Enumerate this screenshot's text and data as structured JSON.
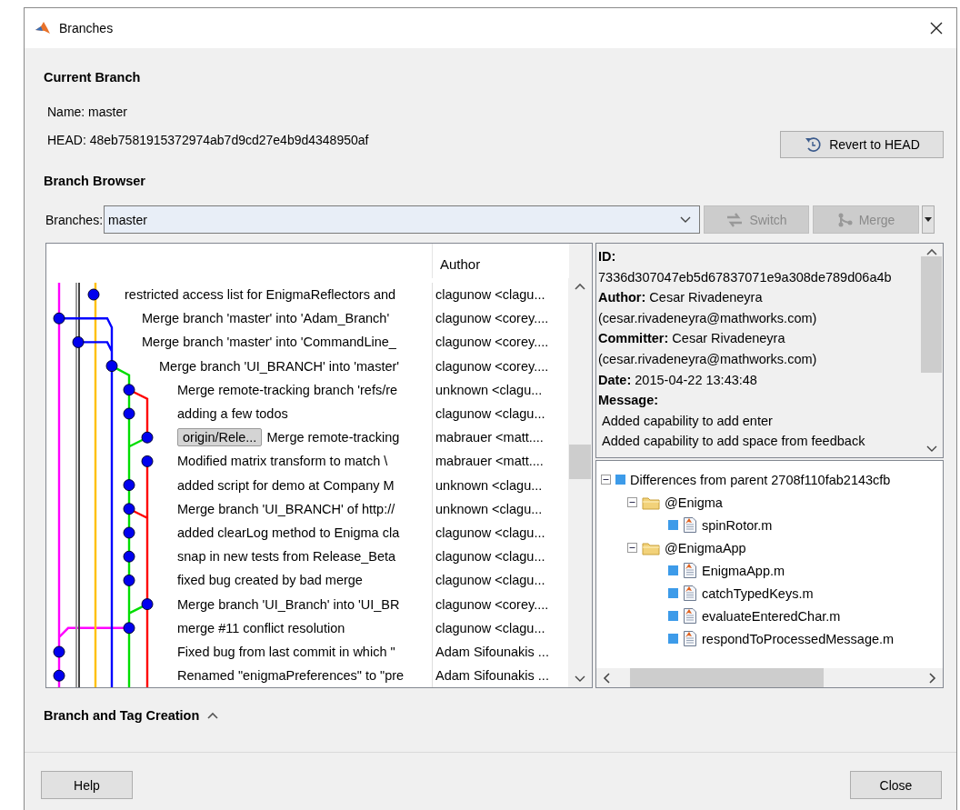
{
  "window": {
    "title": "Branches"
  },
  "current_branch": {
    "heading": "Current Branch",
    "name": "Name: master",
    "head": "HEAD: 48eb7581915372974ab7d9cd27e4b9d4348950af",
    "revert_button": "Revert to HEAD"
  },
  "branch_browser": {
    "heading": "Branch Browser",
    "branches_label": "Branches:",
    "branches_value": "master",
    "switch_button": {
      "label": "Switch",
      "disabled": true
    },
    "merge_button": {
      "label": "Merge",
      "disabled": true
    }
  },
  "commits": {
    "author_header": "Author",
    "rows": [
      {
        "message": "restricted access list for EnigmaReflectors and",
        "author": "clagunow <clagu..."
      },
      {
        "message": "Merge branch 'master' into 'Adam_Branch'",
        "author": "clagunow <corey...."
      },
      {
        "message": "Merge branch 'master' into 'CommandLine_",
        "author": "clagunow <corey...."
      },
      {
        "message": "Merge branch 'UI_BRANCH' into 'master'",
        "author": "clagunow <corey...."
      },
      {
        "message": "Merge remote-tracking branch 'refs/re",
        "author": "unknown <clagu..."
      },
      {
        "message": "adding a few todos",
        "author": "clagunow <clagu..."
      },
      {
        "tag": "origin/Rele...",
        "message": "Merge remote-tracking",
        "author": "mabrauer <matt...."
      },
      {
        "message": "Modified matrix transform to match \\",
        "author": "mabrauer <matt...."
      },
      {
        "message": "added script for demo at Company M",
        "author": "unknown <clagu..."
      },
      {
        "message": "Merge branch 'UI_BRANCH' of http://",
        "author": "unknown <clagu..."
      },
      {
        "message": "added clearLog method to Enigma cla",
        "author": "clagunow <clagu..."
      },
      {
        "message": "snap in new tests from Release_Beta",
        "author": "clagunow <clagu..."
      },
      {
        "message": "fixed bug created by bad merge",
        "author": "clagunow <clagu..."
      },
      {
        "message": "Merge branch 'UI_Branch' into 'UI_BR",
        "author": "clagunow <corey...."
      },
      {
        "message": "merge #11 conflict resolution",
        "author": "clagunow <clagu..."
      },
      {
        "message": "Fixed bug from last commit in which \"",
        "author": "Adam Sifounakis ..."
      },
      {
        "message": "Renamed \"enigmaPreferences\" to \"pre",
        "author": "Adam Sifounakis ..."
      }
    ]
  },
  "details": {
    "lines": [
      {
        "kind": "label",
        "text": "ID:"
      },
      {
        "kind": "value",
        "text": "7336d307047eb5d67837071e9a308de789d06a4b"
      },
      {
        "kind": "value",
        "text": "**Author:** Cesar Rivadeneyra"
      },
      {
        "kind": "value",
        "text": "(cesar.rivadeneyra@mathworks.com)"
      },
      {
        "kind": "value",
        "text": "**Committer:** Cesar Rivadeneyra"
      },
      {
        "kind": "value",
        "text": "(cesar.rivadeneyra@mathworks.com)"
      },
      {
        "kind": "value",
        "text": "**Date:** 2015-04-22 13:43:48"
      },
      {
        "kind": "label",
        "text": "Message:"
      },
      {
        "kind": "message",
        "text": "Added capability to add enter"
      },
      {
        "kind": "message",
        "text": "Added capability to add space from feedback"
      }
    ]
  },
  "changes_tree": [
    {
      "kind": "root",
      "label": "Differences from parent 2708f110fab2143cfb",
      "expanded": true,
      "children": [
        {
          "kind": "folder",
          "label": "@Enigma",
          "expanded": true,
          "children": [
            {
              "kind": "file",
              "label": "spinRotor.m"
            }
          ]
        },
        {
          "kind": "folder",
          "label": "@EnigmaApp",
          "expanded": true,
          "children": [
            {
              "kind": "file",
              "label": "EnigmaApp.m"
            },
            {
              "kind": "file",
              "label": "catchTypedKeys.m"
            },
            {
              "kind": "file",
              "label": "evaluateEnteredChar.m"
            },
            {
              "kind": "file",
              "label": "respondToProcessedMessage.m"
            }
          ]
        }
      ]
    }
  ],
  "creation_section": {
    "label": "Branch and Tag Creation",
    "expanded": false
  },
  "footer": {
    "help_button": "Help",
    "close_button": "Close"
  }
}
